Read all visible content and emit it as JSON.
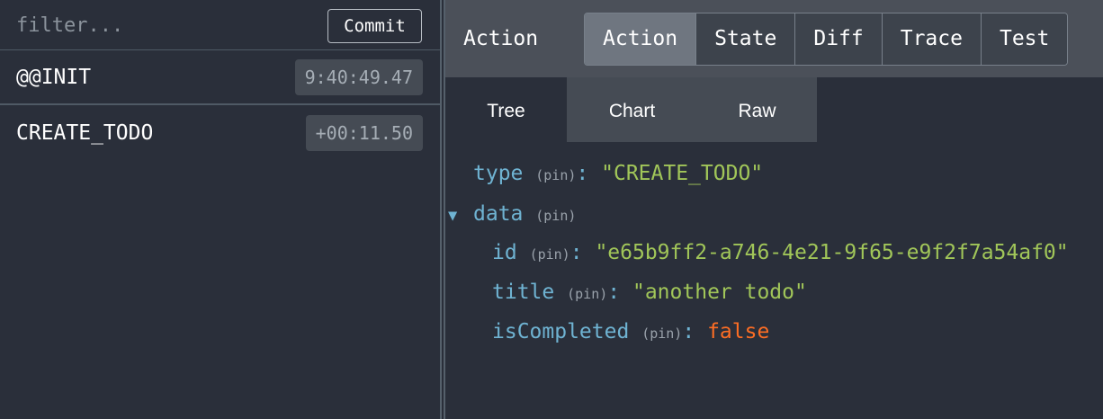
{
  "left": {
    "filter_placeholder": "filter...",
    "commit_label": "Commit",
    "actions": [
      {
        "name": "@@INIT",
        "time": "9:40:49.47"
      },
      {
        "name": "CREATE_TODO",
        "time": "+00:11.50"
      }
    ]
  },
  "right": {
    "header_title": "Action",
    "tabs": [
      {
        "label": "Action",
        "active": true
      },
      {
        "label": "State",
        "active": false
      },
      {
        "label": "Diff",
        "active": false
      },
      {
        "label": "Trace",
        "active": false
      },
      {
        "label": "Test",
        "active": false
      }
    ],
    "subtabs": [
      {
        "label": "Tree",
        "active": true
      },
      {
        "label": "Chart",
        "active": false
      },
      {
        "label": "Raw",
        "active": false
      }
    ],
    "tree": {
      "pin_label": "(pin)",
      "type_key": "type",
      "type_value": "\"CREATE_TODO\"",
      "data_key": "data",
      "toggle_glyph": "▼",
      "id_key": "id",
      "id_value": "\"e65b9ff2-a746-4e21-9f65-e9f2f7a54af0\"",
      "title_key": "title",
      "title_value": "\"another todo\"",
      "completed_key": "isCompleted",
      "completed_value": "false"
    }
  },
  "colors": {
    "background": "#2a2f3a",
    "key": "#6fb3d2",
    "string": "#a1c659",
    "boolean": "#fc6d24",
    "active_tab": "#6f7680"
  }
}
